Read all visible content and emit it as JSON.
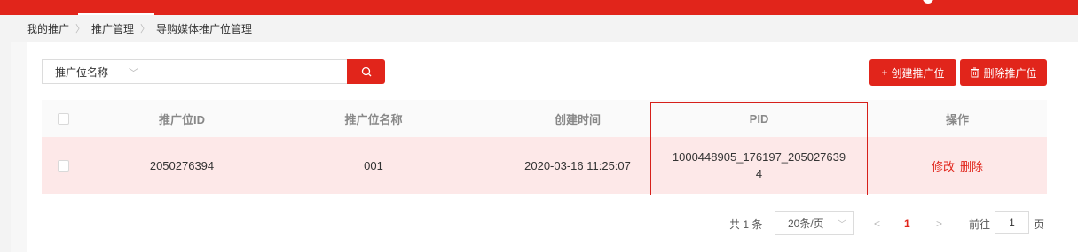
{
  "breadcrumb": [
    "我的推广",
    "推广管理",
    "导购媒体推广位管理"
  ],
  "search": {
    "field_label": "推广位名称",
    "input_value": ""
  },
  "actions": {
    "create_label": "创建推广位",
    "delete_label": "删除推广位"
  },
  "table": {
    "headers": [
      "推广位ID",
      "推广位名称",
      "创建时间",
      "PID",
      "操作"
    ],
    "rows": [
      {
        "id": "2050276394",
        "name": "001",
        "created": "2020-03-16 11:25:07",
        "pid_line1": "1000448905_176197_205027639",
        "pid_line2": "4",
        "edit": "修改",
        "delete": "删除"
      }
    ]
  },
  "pagination": {
    "total": "共 1 条",
    "page_size": "20条/页",
    "current_page": "1",
    "goto_label": "前往",
    "goto_value": "1",
    "page_suffix": "页"
  },
  "colors": {
    "accent": "#e1251b",
    "row_highlight": "#fde8e8"
  }
}
